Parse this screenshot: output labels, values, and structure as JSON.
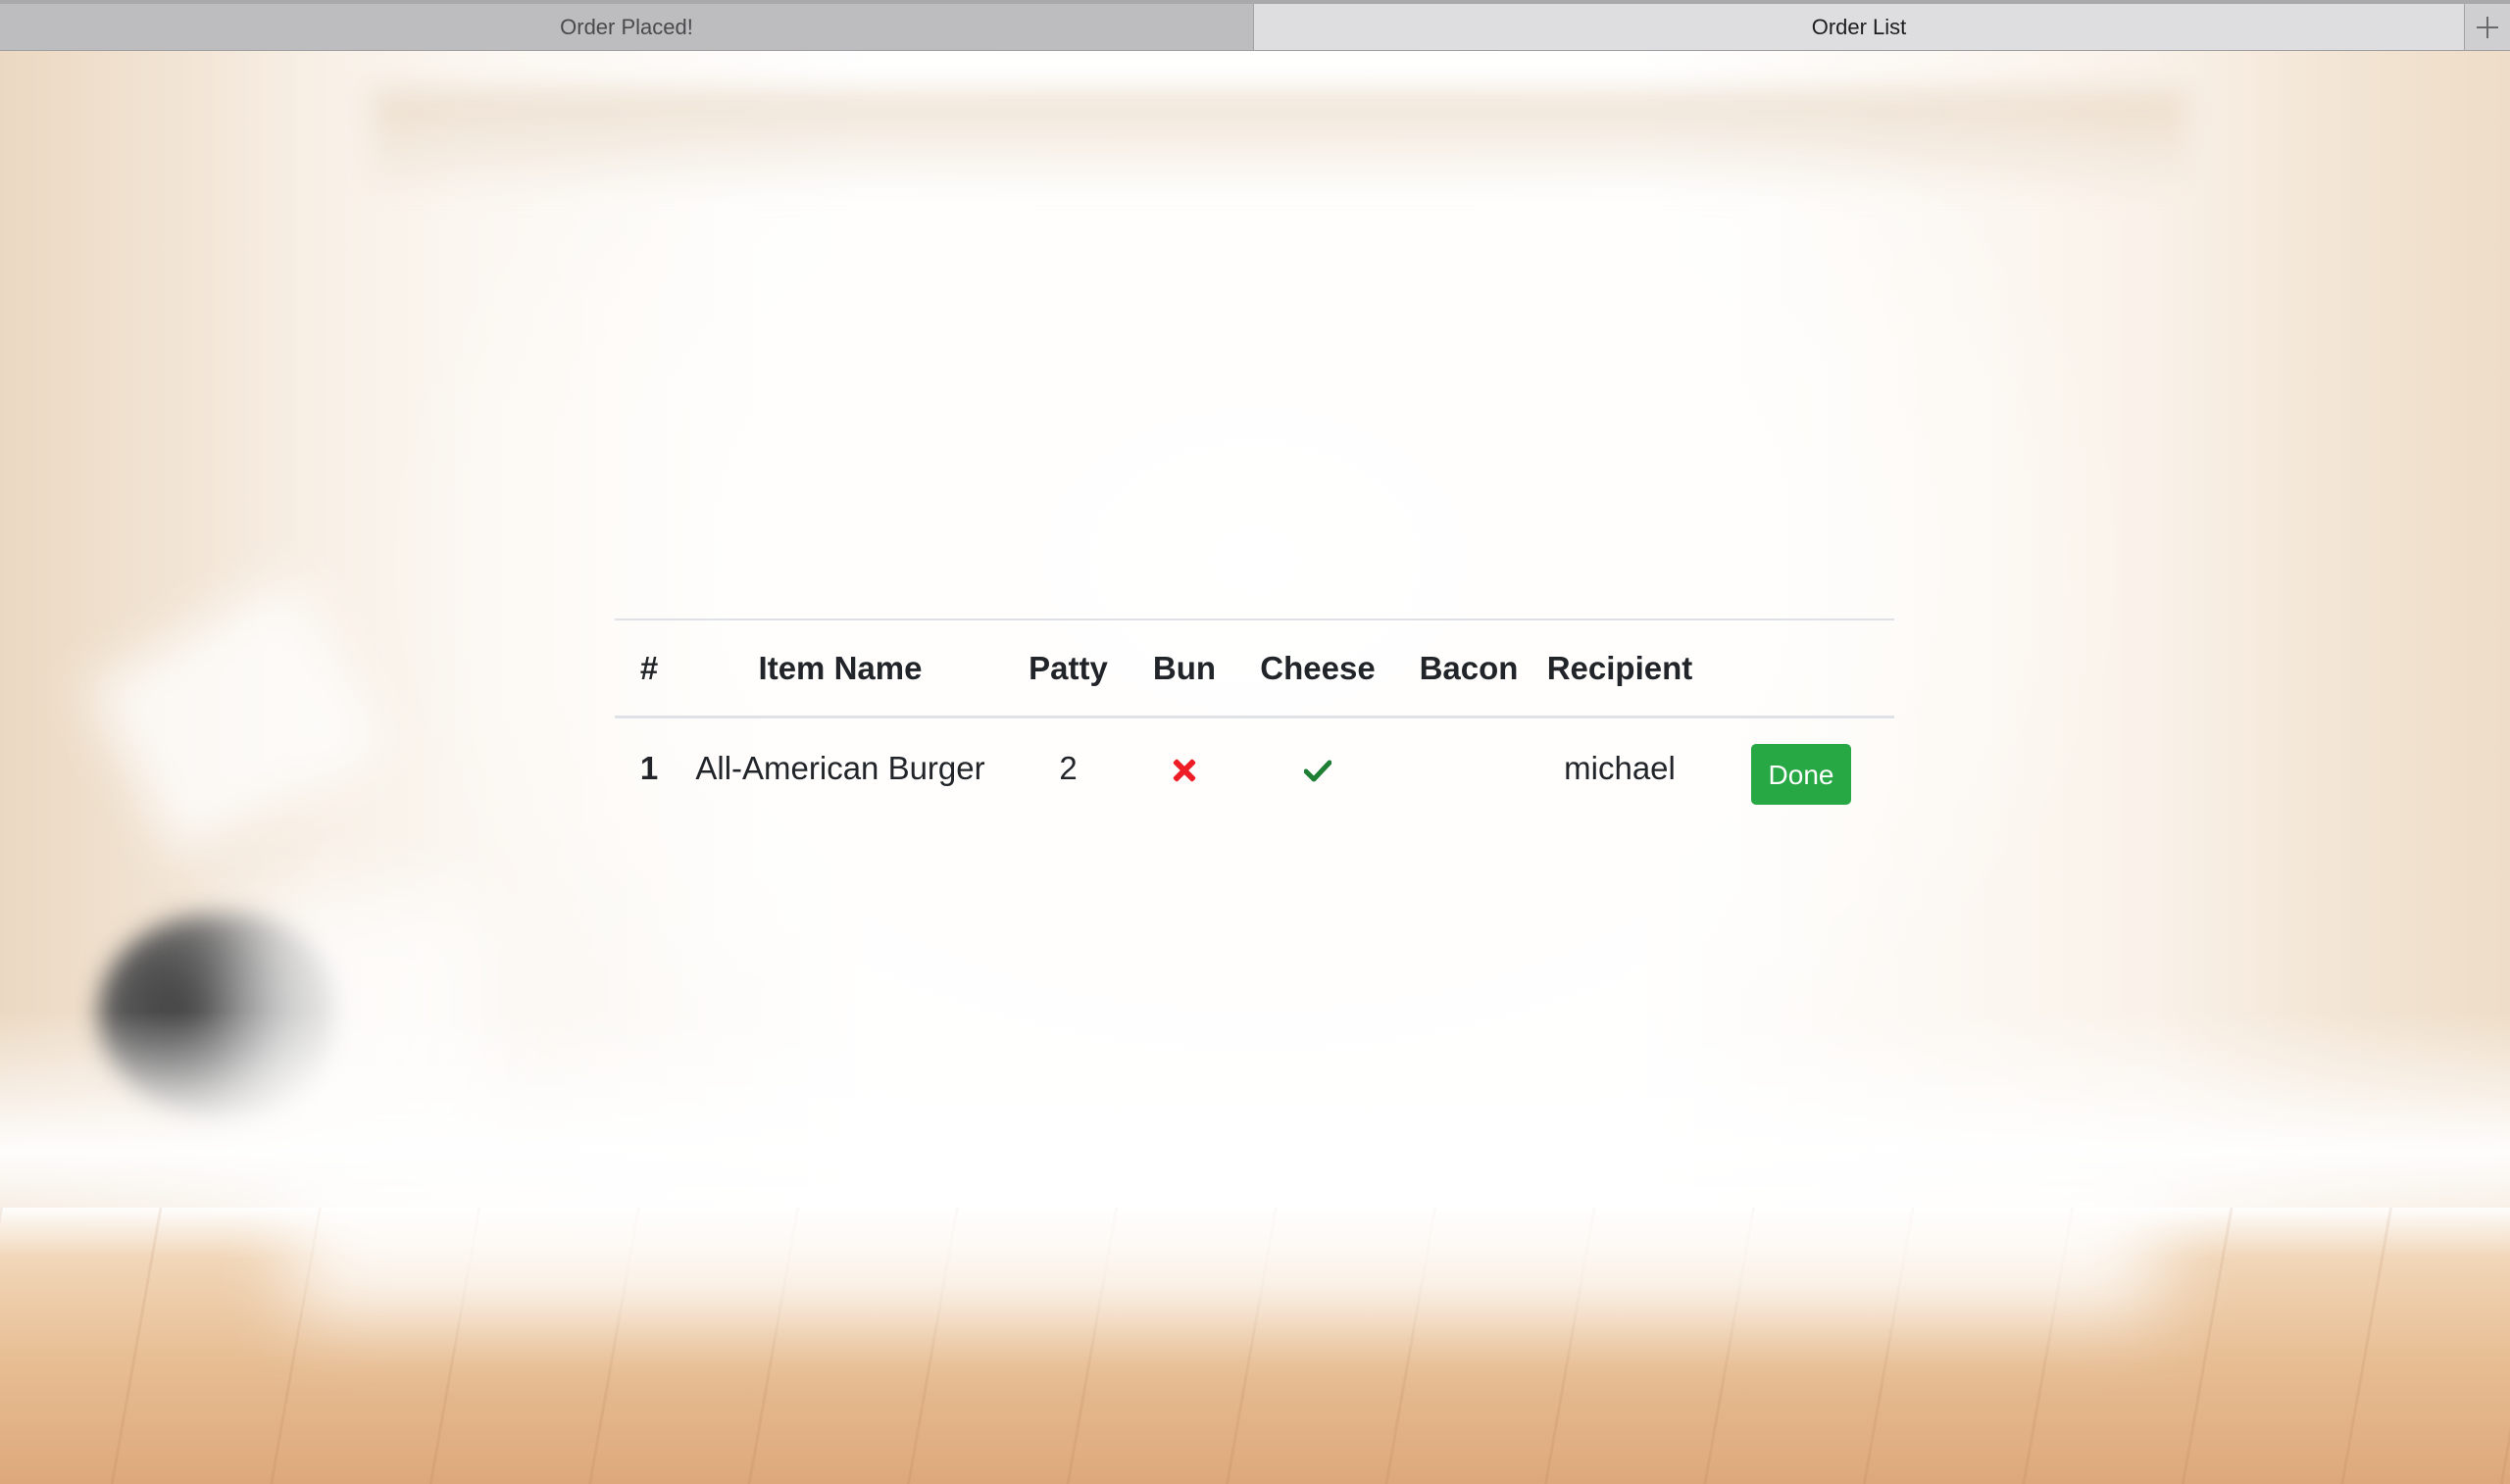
{
  "browser": {
    "tabs": [
      {
        "label": "Order Placed!",
        "active": false
      },
      {
        "label": "Order List",
        "active": true
      }
    ],
    "new_tab_icon": "plus-icon"
  },
  "orders_table": {
    "headers": {
      "number": "#",
      "item_name": "Item Name",
      "patty": "Patty",
      "bun": "Bun",
      "cheese": "Cheese",
      "bacon": "Bacon",
      "recipient": "Recipient"
    },
    "rows": [
      {
        "number": "1",
        "item_name": "All-American Burger",
        "patty": "2",
        "bun_icon": "x-icon",
        "bun": false,
        "cheese_icon": "check-icon",
        "cheese": true,
        "bacon": "",
        "recipient": "michael",
        "action_label": "Done"
      }
    ]
  },
  "colors": {
    "done_button": "#28a745",
    "x_icon": "#ee1c25",
    "check_icon": "#1e7e34"
  }
}
